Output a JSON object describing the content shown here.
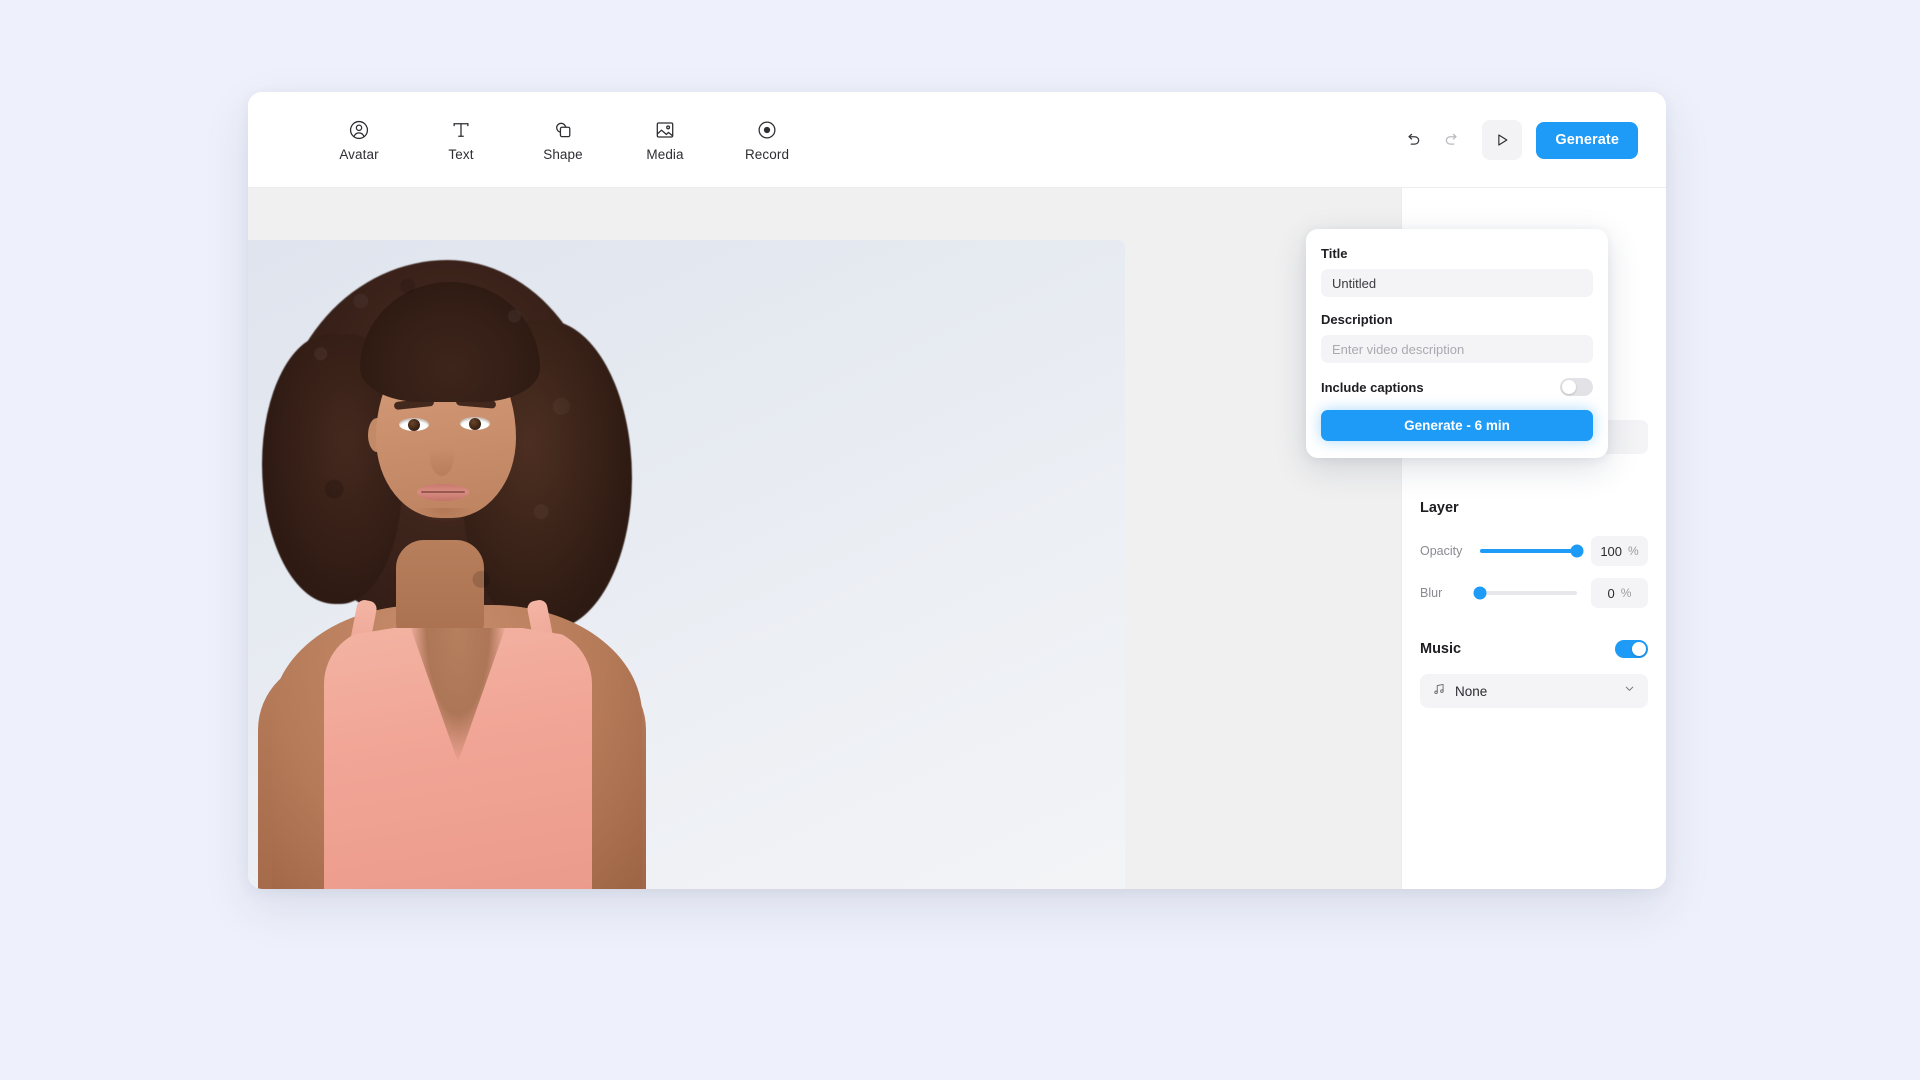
{
  "toolbar": {
    "tools": [
      {
        "label": "Avatar",
        "icon": "avatar-icon"
      },
      {
        "label": "Text",
        "icon": "text-icon"
      },
      {
        "label": "Shape",
        "icon": "shape-icon"
      },
      {
        "label": "Media",
        "icon": "media-icon"
      },
      {
        "label": "Record",
        "icon": "record-icon"
      }
    ],
    "undo_icon": "undo-icon",
    "redo_icon": "redo-icon",
    "play_icon": "play-icon",
    "generate_label": "Generate"
  },
  "generate_popover": {
    "title_label": "Title",
    "title_value": "Untitled",
    "title_placeholder": "Untitled",
    "description_label": "Description",
    "description_value": "",
    "description_placeholder": "Enter video description",
    "captions_label": "Include captions",
    "captions_enabled": false,
    "submit_label": "Generate - 6 min"
  },
  "properties_panel": {
    "layer": {
      "title": "Layer",
      "opacity": {
        "label": "Opacity",
        "value": "100",
        "unit": "%",
        "percent": 100
      },
      "blur": {
        "label": "Blur",
        "value": "0",
        "unit": "%",
        "percent": 0
      }
    },
    "music": {
      "title": "Music",
      "enabled": true,
      "selected": "None",
      "note_icon": "music-note-icon",
      "chevron_icon": "chevron-down-icon"
    }
  },
  "colors": {
    "accent": "#1e9bf7",
    "page_background": "#eef1fb",
    "panel_background": "#ffffff",
    "canvas_background": "#f0f0f0",
    "field_background": "#f4f4f6"
  }
}
